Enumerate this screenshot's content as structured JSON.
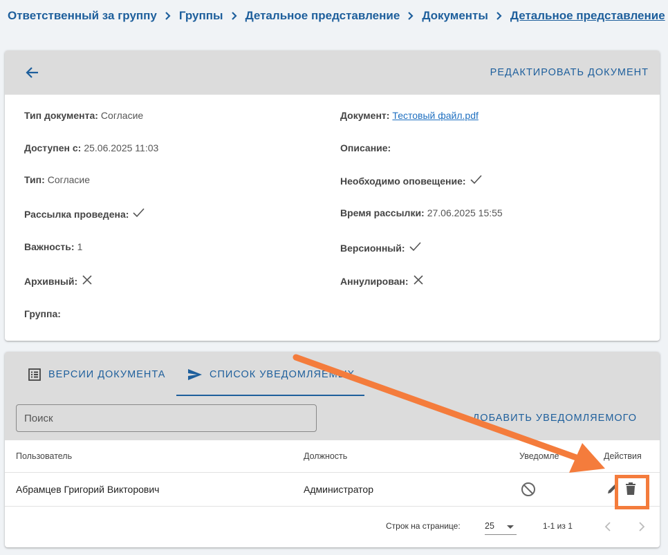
{
  "breadcrumbs": [
    "Ответственный за группу",
    "Группы",
    "Детальное представление",
    "Документы",
    "Детальное представление"
  ],
  "header": {
    "edit_label": "РЕДАКТИРОВАТЬ ДОКУМЕНТ"
  },
  "details": {
    "doc_type_label": "Тип документа:",
    "doc_type_value": "Согласие",
    "document_label": "Документ:",
    "document_value": "Тестовый файл.pdf",
    "available_label": "Доступен с:",
    "available_value": "25.06.2025 11:03",
    "description_label": "Описание:",
    "type_label": "Тип:",
    "type_value": "Согласие",
    "notify_required_label": "Необходимо оповещение:",
    "notify_required": true,
    "mailing_done_label": "Рассылка проведена:",
    "mailing_done": true,
    "mailing_time_label": "Время рассылки:",
    "mailing_time_value": "27.06.2025 15:55",
    "importance_label": "Важность:",
    "importance_value": "1",
    "versioned_label": "Версионный:",
    "versioned": true,
    "archived_label": "Архивный:",
    "archived": false,
    "annulled_label": "Аннулирован:",
    "annulled": false,
    "group_label": "Группа:"
  },
  "tabs": [
    {
      "label": "ВЕРСИИ ДОКУМЕНТА",
      "icon": "list-icon"
    },
    {
      "label": "СПИСОК УВЕДОМЛЯЕМЫХ",
      "icon": "send-icon",
      "active": true
    }
  ],
  "toolbar": {
    "search_placeholder": "Поиск",
    "add_label": "ДОБАВИТЬ УВЕДОМЛЯЕМОГО"
  },
  "table": {
    "headers": {
      "user": "Пользователь",
      "position": "Должность",
      "notified": "Уведомле",
      "actions": "Действия"
    },
    "rows": [
      {
        "user": "Абрамцев Григорий Викторович",
        "position": "Администратор",
        "notified_icon": "block-icon"
      }
    ]
  },
  "pagination": {
    "rows_label": "Строк на странице:",
    "rows_value": "25",
    "range": "1-1 из 1"
  },
  "colors": {
    "accent": "#1e5f9c",
    "annotation": "#f47c3c"
  }
}
